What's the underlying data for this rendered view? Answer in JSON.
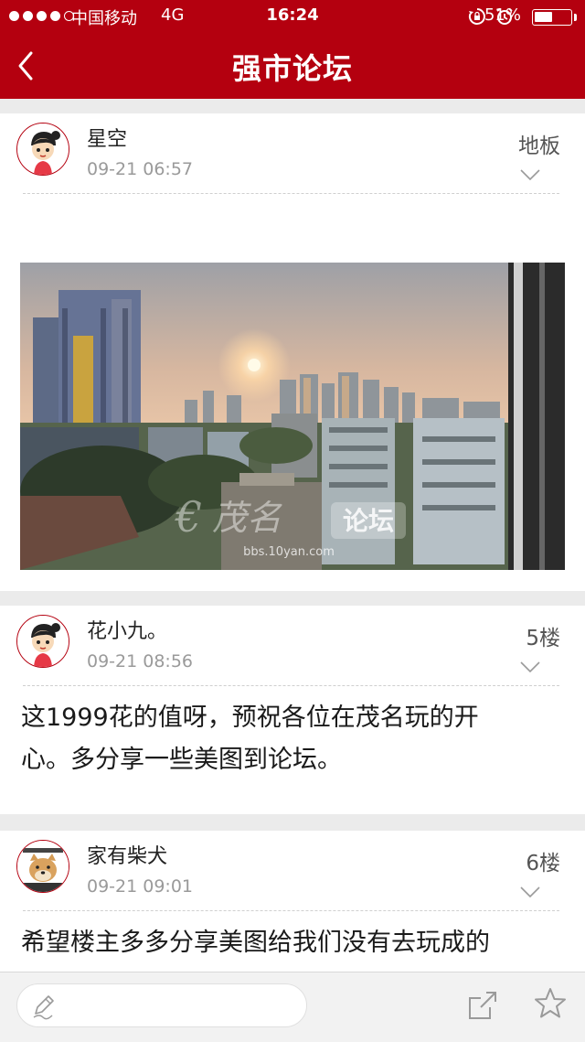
{
  "status_bar": {
    "carrier": "中国移动",
    "network": "4G",
    "time": "16:24",
    "battery_percent": "51%",
    "battery_level": 0.51,
    "signal_bars_filled": 4,
    "signal_bars_total": 5
  },
  "nav": {
    "title": "强市论坛",
    "back_icon": "chevron-left-icon"
  },
  "posts": [
    {
      "author": "星空",
      "date": "09-21 06:57",
      "floor": "地板",
      "has_image": true,
      "image_watermark": {
        "brand": "论坛",
        "url": "bbs.10yan.com"
      }
    },
    {
      "author": "花小九。",
      "date": "09-21 08:56",
      "floor": "5楼",
      "content_lines": [
        "这1999花的值呀，预祝各位在茂名玩的开",
        "心。多分享一些美图到论坛。"
      ]
    },
    {
      "author": "家有柴犬",
      "date": "09-21 09:01",
      "floor": "6楼",
      "content_lines": [
        "希望楼主多多分享美图给我们没有去玩成的"
      ]
    }
  ],
  "toolbar": {
    "reply_icon": "pencil-icon",
    "share_icon": "share-icon",
    "favorite_icon": "star-icon"
  },
  "colors": {
    "brand_red": "#b4000f",
    "avatar_border": "#b4000f",
    "meta_gray": "#9a9a9a"
  }
}
